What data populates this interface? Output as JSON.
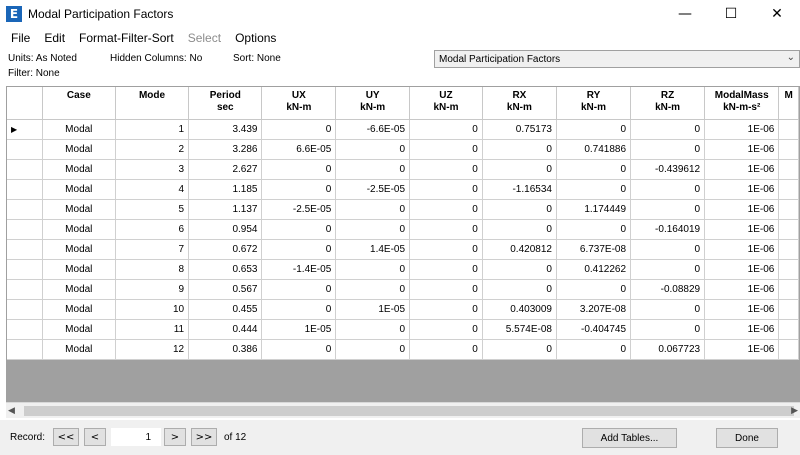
{
  "window": {
    "icon_letter": "E",
    "title": "Modal Participation Factors",
    "minimize_glyph": "—",
    "maximize_glyph": "☐",
    "close_glyph": "✕"
  },
  "menu": [
    "File",
    "Edit",
    "Format-Filter-Sort",
    "Select",
    "Options"
  ],
  "info": {
    "units": "Units:  As Noted",
    "hidden_columns": "Hidden Columns:  No",
    "sort": "Sort:  None",
    "filter": "Filter:  None",
    "table_selector": "Modal Participation Factors"
  },
  "columns": [
    {
      "title": "Case",
      "unit": ""
    },
    {
      "title": "Mode",
      "unit": ""
    },
    {
      "title": "Period",
      "unit": "sec"
    },
    {
      "title": "UX",
      "unit": "kN-m"
    },
    {
      "title": "UY",
      "unit": "kN-m"
    },
    {
      "title": "UZ",
      "unit": "kN-m"
    },
    {
      "title": "RX",
      "unit": "kN-m"
    },
    {
      "title": "RY",
      "unit": "kN-m"
    },
    {
      "title": "RZ",
      "unit": "kN-m"
    },
    {
      "title": "ModalMass",
      "unit": "kN-m-s²"
    },
    {
      "title": "M",
      "unit": ""
    }
  ],
  "rows": [
    [
      "Modal",
      "1",
      "3.439",
      "0",
      "-6.6E-05",
      "0",
      "0.75173",
      "0",
      "0",
      "1E-06"
    ],
    [
      "Modal",
      "2",
      "3.286",
      "6.6E-05",
      "0",
      "0",
      "0",
      "0.741886",
      "0",
      "1E-06"
    ],
    [
      "Modal",
      "3",
      "2.627",
      "0",
      "0",
      "0",
      "0",
      "0",
      "-0.439612",
      "1E-06"
    ],
    [
      "Modal",
      "4",
      "1.185",
      "0",
      "-2.5E-05",
      "0",
      "-1.16534",
      "0",
      "0",
      "1E-06"
    ],
    [
      "Modal",
      "5",
      "1.137",
      "-2.5E-05",
      "0",
      "0",
      "0",
      "1.174449",
      "0",
      "1E-06"
    ],
    [
      "Modal",
      "6",
      "0.954",
      "0",
      "0",
      "0",
      "0",
      "0",
      "-0.164019",
      "1E-06"
    ],
    [
      "Modal",
      "7",
      "0.672",
      "0",
      "1.4E-05",
      "0",
      "0.420812",
      "6.737E-08",
      "0",
      "1E-06"
    ],
    [
      "Modal",
      "8",
      "0.653",
      "-1.4E-05",
      "0",
      "0",
      "0",
      "0.412262",
      "0",
      "1E-06"
    ],
    [
      "Modal",
      "9",
      "0.567",
      "0",
      "0",
      "0",
      "0",
      "0",
      "-0.08829",
      "1E-06"
    ],
    [
      "Modal",
      "10",
      "0.455",
      "0",
      "1E-05",
      "0",
      "0.403009",
      "3.207E-08",
      "0",
      "1E-06"
    ],
    [
      "Modal",
      "11",
      "0.444",
      "1E-05",
      "0",
      "0",
      "5.574E-08",
      "-0.404745",
      "0",
      "1E-06"
    ],
    [
      "Modal",
      "12",
      "0.386",
      "0",
      "0",
      "0",
      "0",
      "0",
      "0.067723",
      "1E-06"
    ]
  ],
  "current_row_marker": "▶",
  "scroll": {
    "left": "◀",
    "right": "▶"
  },
  "footer": {
    "record_label": "Record:",
    "first": "<<",
    "prev": "<",
    "record_value": "1",
    "next": ">",
    "last": ">>",
    "of_label": "of 12",
    "add_tables": "Add Tables...",
    "done": "Done"
  }
}
